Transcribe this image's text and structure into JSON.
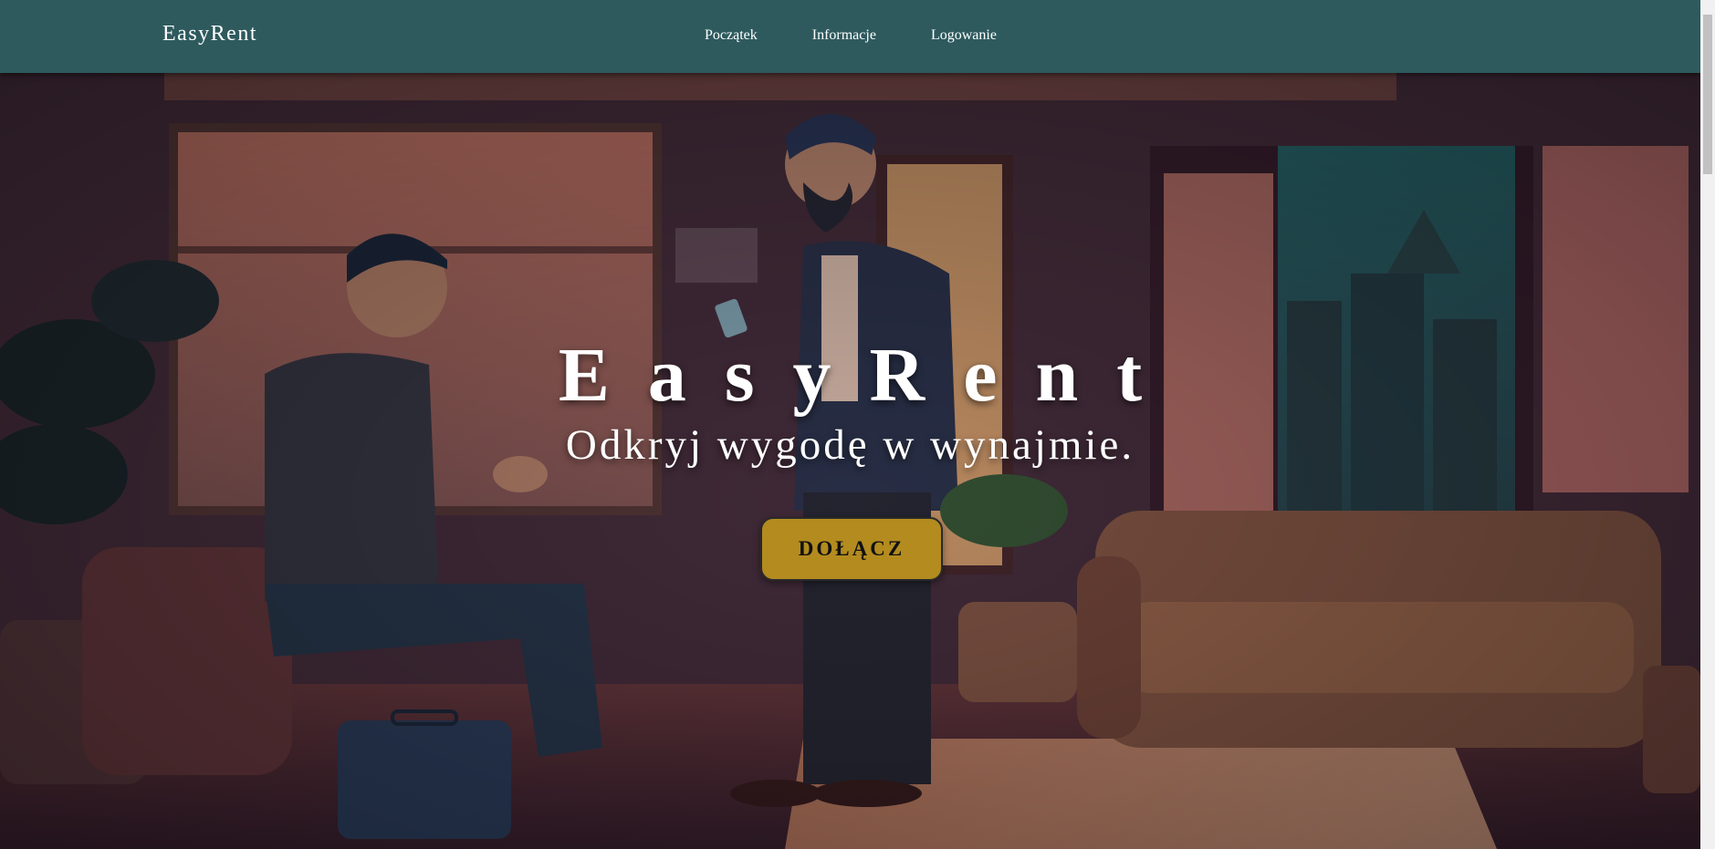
{
  "header": {
    "brand": "EasyRent",
    "nav": [
      {
        "label": "Początek"
      },
      {
        "label": "Informacje"
      },
      {
        "label": "Logowanie"
      }
    ],
    "background_color": "#2e5a5e"
  },
  "hero": {
    "title": "EasyRent",
    "subtitle": "Odkryj wygodę w wynajmie.",
    "cta_label": "DOŁĄCZ",
    "cta_color": "#b38b1f",
    "illustration": "two-men-talking-in-apartment-illustration"
  }
}
